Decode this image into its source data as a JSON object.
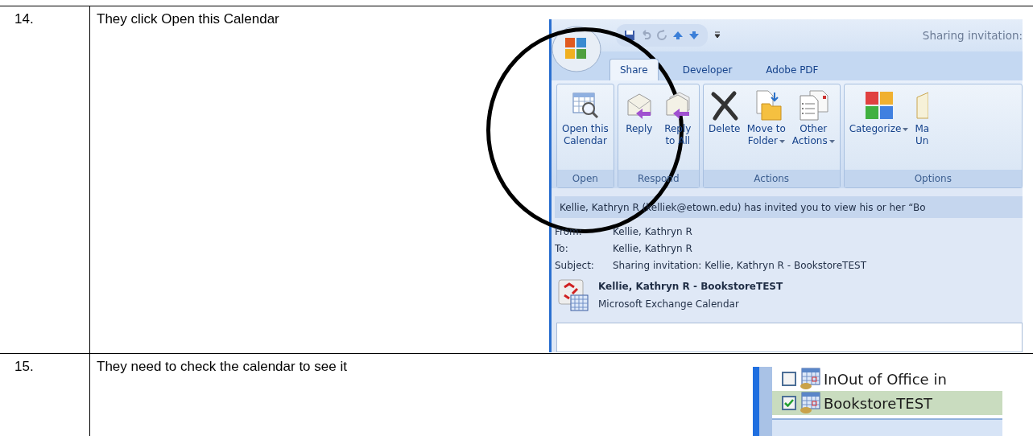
{
  "document": {
    "steps": [
      {
        "number": "14.",
        "instruction": "They click Open this Calendar",
        "screenshot": {
          "kind": "message",
          "title": "Sharing invitation:",
          "tabs": [
            {
              "label": "Share",
              "selected": true
            },
            {
              "label": "Developer",
              "selected": false
            },
            {
              "label": "Adobe PDF",
              "selected": false
            }
          ],
          "ribbon_groups": [
            {
              "label": "Open",
              "buttons": [
                {
                  "kind": "calendar",
                  "label": "Open this\nCalendar",
                  "dropdown": false
                }
              ]
            },
            {
              "label": "Respond",
              "buttons": [
                {
                  "kind": "reply",
                  "label": "Reply",
                  "dropdown": false
                },
                {
                  "kind": "reply-all",
                  "label": "Reply\nto All",
                  "dropdown": false
                }
              ]
            },
            {
              "label": "Actions",
              "buttons": [
                {
                  "kind": "delete",
                  "label": "Delete",
                  "dropdown": false
                },
                {
                  "kind": "move",
                  "label": "Move to\nFolder",
                  "dropdown": true
                },
                {
                  "kind": "other",
                  "label": "Other\nActions",
                  "dropdown": true
                }
              ]
            },
            {
              "label": "Options",
              "buttons": [
                {
                  "kind": "categorize",
                  "label": "Categorize",
                  "dropdown": true
                },
                {
                  "kind": "mark",
                  "label": "Ma\nUn",
                  "dropdown": false
                }
              ]
            }
          ],
          "info_bar": "Kellie, Kathryn R (kelliek@etown.edu) has invited you to view his or her “Bo",
          "fields": [
            {
              "label": "From:",
              "value": "Kellie, Kathryn R"
            },
            {
              "label": "To:",
              "value": "Kellie, Kathryn R"
            },
            {
              "label": "Subject:",
              "value": "Sharing invitation: Kellie, Kathryn R - BookstoreTEST"
            }
          ],
          "attachment": {
            "name": "Kellie, Kathryn R - BookstoreTEST",
            "type": "Microsoft Exchange Calendar"
          }
        }
      },
      {
        "number": "15.",
        "instruction": "They need to check the calendar to see it",
        "screenshot": {
          "kind": "navigation",
          "items": [
            {
              "label": "InOut of Office in",
              "checked": false,
              "selected": false
            },
            {
              "label": "BookstoreTEST",
              "checked": true,
              "selected": true
            }
          ]
        }
      }
    ]
  }
}
